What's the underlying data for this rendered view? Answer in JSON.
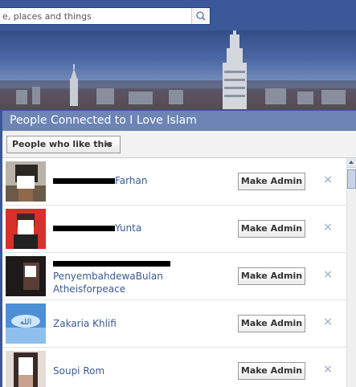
{
  "search": {
    "value": "e, places and things",
    "icon": "search-icon"
  },
  "dialog": {
    "title": "People Connected to I Love Islam",
    "filter_label": "People who like this"
  },
  "people": [
    {
      "name": "Farhan",
      "name2": "",
      "button": "Make Admin",
      "close": "×",
      "avatar_text": ""
    },
    {
      "name": "Yunta",
      "name2": "",
      "button": "Make Admin",
      "close": "×",
      "avatar_text": ""
    },
    {
      "name": "PenyembahdewaBulan",
      "name2": "Atheisforpeace",
      "button": "Make Admin",
      "close": "×",
      "avatar_text": ""
    },
    {
      "name": "Zakaria Khlifi",
      "name2": "",
      "button": "Make Admin",
      "close": "×",
      "avatar_text": "الله"
    },
    {
      "name": "Soupi Rom",
      "name2": "",
      "button": "Make Admin",
      "close": "×",
      "avatar_text": ""
    }
  ],
  "colors": {
    "brand": "#3b5998",
    "title_bar": "#6d84b4",
    "link": "#3b5998"
  }
}
